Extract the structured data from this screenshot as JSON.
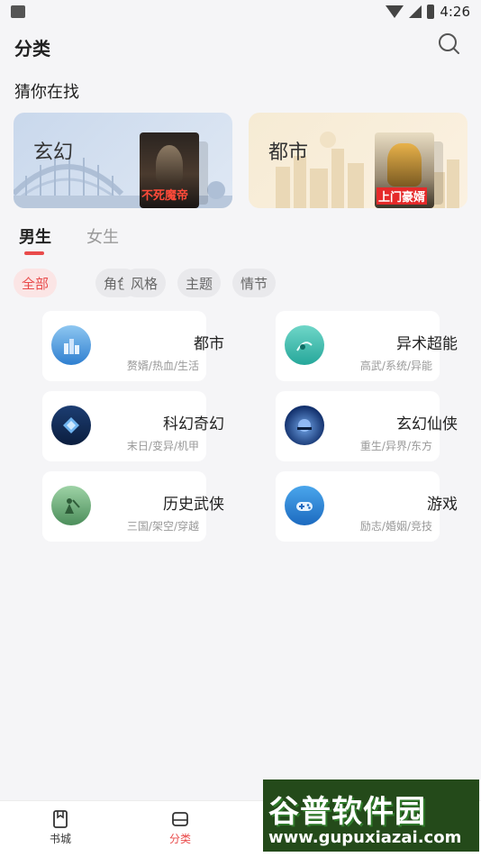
{
  "status_bar": {
    "time": "4:26"
  },
  "header": {
    "title": "分类",
    "search_icon": "search-icon"
  },
  "recommend": {
    "title": "猜你在找",
    "cards": [
      {
        "label": "玄幻",
        "cover_title": "不死魔帝",
        "color": "#c9d8ec"
      },
      {
        "label": "都市",
        "cover_title": "上门豪婿",
        "color": "#f6ebd4"
      }
    ]
  },
  "gender_tabs": [
    {
      "label": "男生",
      "active": true
    },
    {
      "label": "女生",
      "active": false
    }
  ],
  "filter_chips": [
    {
      "label": "全部",
      "active": true
    },
    {
      "label": "角色",
      "active": false
    },
    {
      "label": "风格",
      "active": false
    },
    {
      "label": "主题",
      "active": false
    },
    {
      "label": "情节",
      "active": false
    }
  ],
  "categories": [
    {
      "name": "都市",
      "tags": "赘婿/热血/生活",
      "icon": "city-icon"
    },
    {
      "name": "异术超能",
      "tags": "高武/系统/异能",
      "icon": "superpower-icon"
    },
    {
      "name": "科幻奇幻",
      "tags": "末日/变异/机甲",
      "icon": "scifi-icon"
    },
    {
      "name": "玄幻仙侠",
      "tags": "重生/异界/东方",
      "icon": "fantasy-icon"
    },
    {
      "name": "历史武侠",
      "tags": "三国/架空/穿越",
      "icon": "history-icon"
    },
    {
      "name": "游戏",
      "tags": "励志/婚姻/竞技",
      "icon": "gamepad-icon"
    }
  ],
  "bottom_nav": [
    {
      "label": "书城",
      "active": false,
      "icon": "bookstore-icon"
    },
    {
      "label": "分类",
      "active": true,
      "icon": "category-icon"
    }
  ],
  "watermark": {
    "title": "谷普软件园",
    "url": "www.gupuxiazai.com"
  },
  "colors": {
    "accent": "#e94b4b",
    "background": "#f5f5f7"
  }
}
